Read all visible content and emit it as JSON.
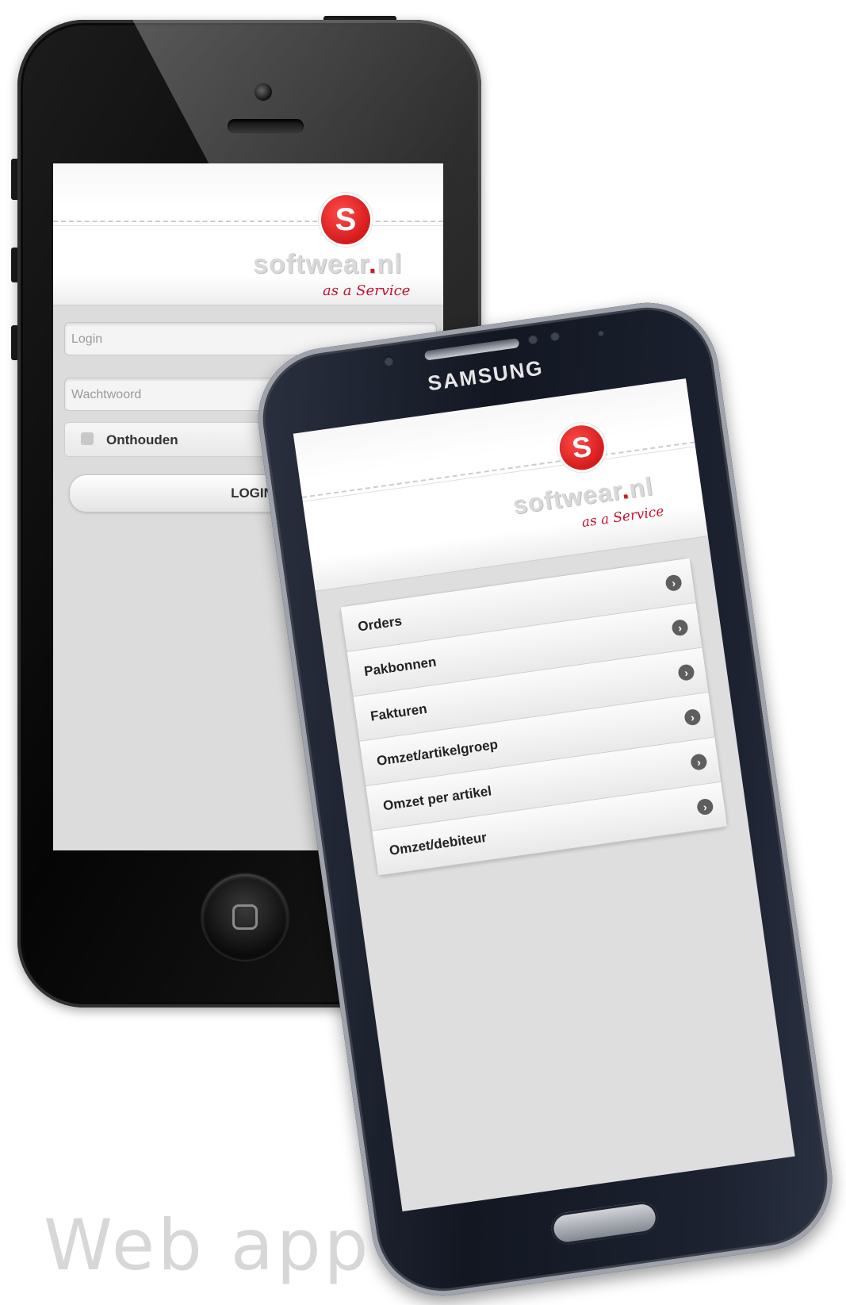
{
  "iphone": {
    "logo": {
      "letter": "S",
      "word_main": "softwear",
      "word_dot": ".",
      "word_tld": "nl",
      "tagline": "as a Service"
    },
    "login_form": {
      "login_placeholder": "Login",
      "password_placeholder": "Wachtwoord",
      "remember_label": "Onthouden",
      "login_button": "LOGIN"
    }
  },
  "samsung": {
    "brand": "SAMSUNG",
    "logo": {
      "letter": "S",
      "word_main": "softwear",
      "word_dot": ".",
      "word_tld": "nl",
      "tagline": "as a Service"
    },
    "menu": [
      {
        "label": "Orders"
      },
      {
        "label": "Pakbonnen"
      },
      {
        "label": "Fakturen"
      },
      {
        "label": "Omzet/artikelgroep"
      },
      {
        "label": "Omzet per artikel"
      },
      {
        "label": "Omzet/debiteur"
      }
    ]
  },
  "caption": "Web app",
  "colors": {
    "brand_red": "#d41b1b"
  }
}
